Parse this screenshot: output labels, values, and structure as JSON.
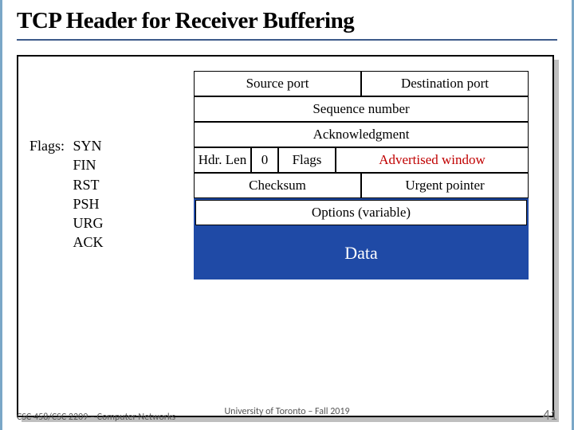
{
  "title": "TCP Header for Receiver Buffering",
  "flags": {
    "label": "Flags:",
    "items": [
      "SYN",
      "FIN",
      "RST",
      "PSH",
      "URG",
      "ACK"
    ]
  },
  "header": {
    "source_port": "Source port",
    "dest_port": "Destination port",
    "sequence": "Sequence number",
    "ack": "Acknowledgment",
    "hdrlen": "Hdr. Len",
    "reserved": "0",
    "flags_cell": "Flags",
    "adv_window": "Advertised window",
    "checksum": "Checksum",
    "urgent": "Urgent pointer",
    "options": "Options (variable)",
    "data": "Data"
  },
  "footer": {
    "left": "CSC 458/CSC 2209 – Computer Networks",
    "center": "University of Toronto – Fall 2019",
    "right": "41"
  }
}
